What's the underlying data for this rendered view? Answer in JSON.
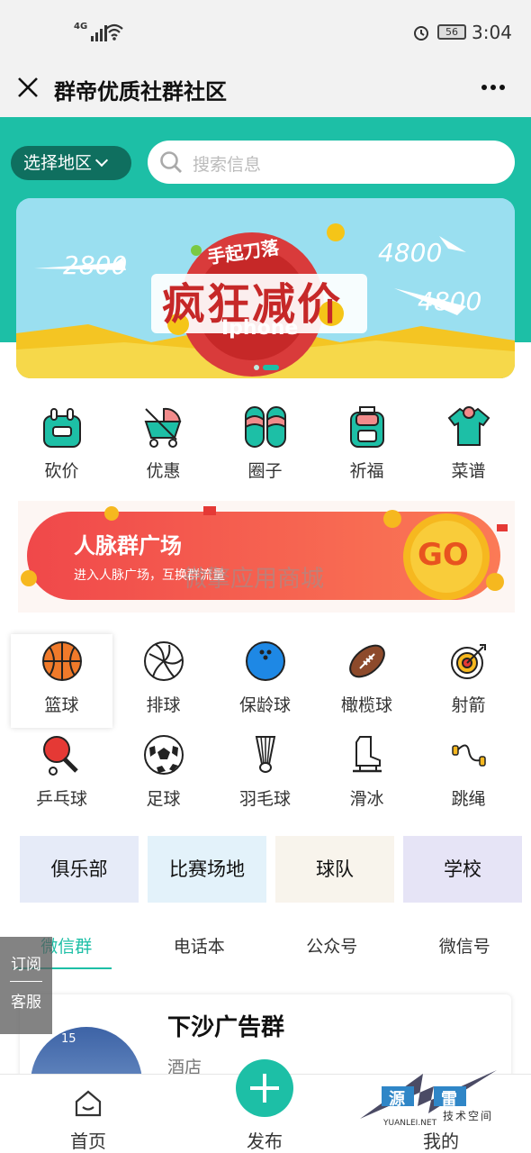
{
  "status_bar": {
    "network": "4G",
    "battery": "56",
    "time": "3:04"
  },
  "header": {
    "title": "群帝优质社群社区"
  },
  "search": {
    "region_label": "选择地区",
    "placeholder": "搜索信息"
  },
  "banner": {
    "tagline": "手起刀落",
    "headline": "疯狂减价",
    "product": "Iphone",
    "prices": [
      "2800",
      "4800",
      "4800"
    ]
  },
  "categories": [
    "砍价",
    "优惠",
    "圈子",
    "祈福",
    "菜谱"
  ],
  "promo": {
    "title": "人脉群广场",
    "subtitle": "进入人脉广场，互换群流量",
    "button": "GO",
    "watermark": "微擎应用商城"
  },
  "sports": [
    "篮球",
    "排球",
    "保龄球",
    "橄榄球",
    "射箭",
    "乒乓球",
    "足球",
    "羽毛球",
    "滑冰",
    "跳绳"
  ],
  "tags": [
    {
      "label": "俱乐部",
      "bg": "#e6ebf8"
    },
    {
      "label": "比赛场地",
      "bg": "#e3f2fa"
    },
    {
      "label": "球队",
      "bg": "#f8f4ec"
    },
    {
      "label": "学校",
      "bg": "#e6e4f6"
    }
  ],
  "tabs": [
    "微信群",
    "电话本",
    "公众号",
    "微信号"
  ],
  "side_float": {
    "subscribe": "订阅",
    "service": "客服"
  },
  "group": {
    "title": "下沙广告群",
    "category": "酒店",
    "thumb_text": "15"
  },
  "bottom_nav": {
    "home": "首页",
    "publish": "发布",
    "mine": "我的"
  },
  "corner_watermark": {
    "cn1": "源",
    "cn2": "雷",
    "sub": "技术空间",
    "url": "YUANLEI.NET"
  },
  "colors": {
    "accent": "#1dbfa6",
    "accent_dark": "#0f6f5f",
    "promo_red": "#f04a4a"
  }
}
